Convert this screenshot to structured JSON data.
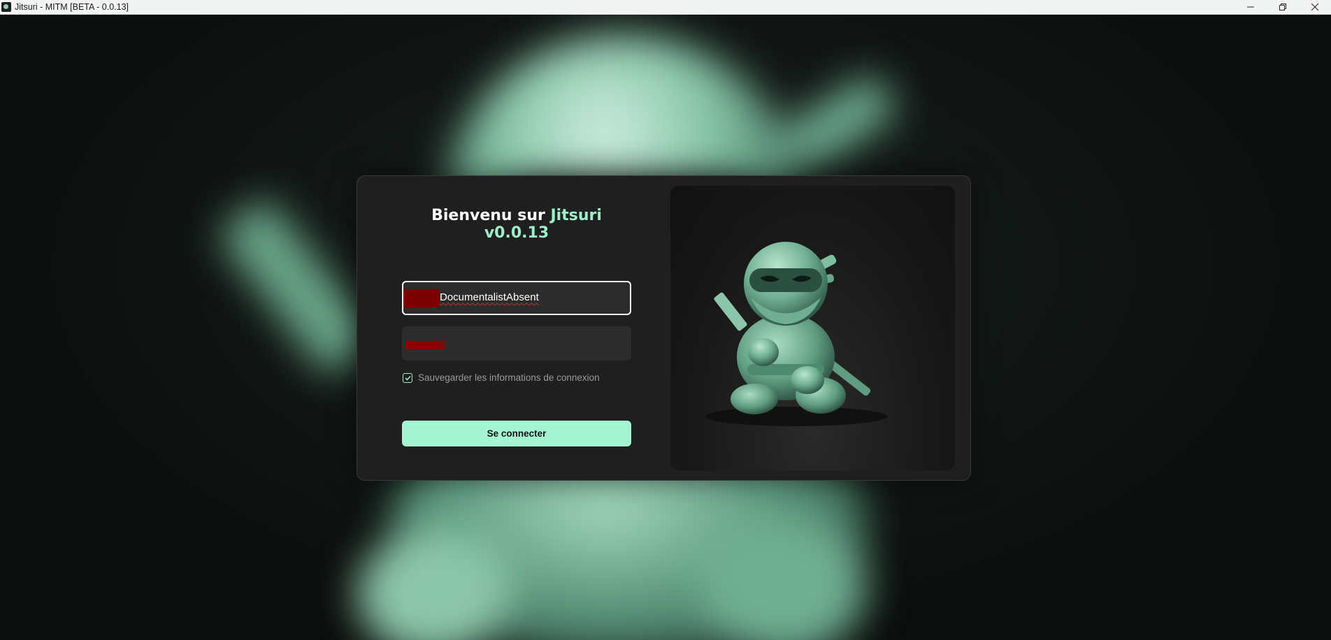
{
  "window": {
    "title": "Jitsuri - MITM [BETA - 0.0.13]",
    "controls": {
      "minimize": "–",
      "restore": "❐",
      "close": "✕"
    }
  },
  "login": {
    "welcome_prefix": "Bienvenu sur ",
    "welcome_brand": "Jitsuri v0.0.13",
    "username_value": "DocumentalistAbsent",
    "password_value": "",
    "remember_label": "Sauvegarder les informations de connexion",
    "remember_checked": true,
    "submit_label": "Se connecter"
  },
  "theme": {
    "accent": "#9ef0c9",
    "button_bg": "#a6f5d2",
    "dialog_bg": "#1f1f1f",
    "redaction": "#7a0000"
  },
  "icons": {
    "app": "jitsuri-app-icon",
    "checkbox": "check-icon",
    "hero": "ninja-mascot-illustration"
  }
}
